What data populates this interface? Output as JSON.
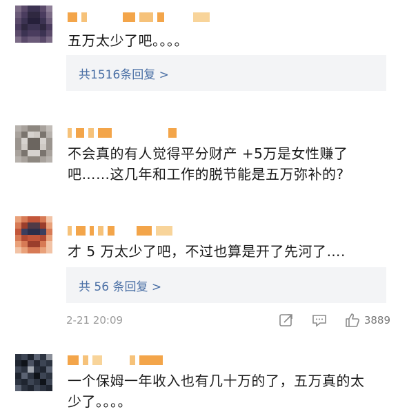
{
  "comments": [
    {
      "text_lines": [
        "五万太少了吧。。。。"
      ],
      "replies": "共1516条回复 >"
    },
    {
      "text_lines": [
        "不会真的有人觉得平分财产 +5万是女性赚了",
        "吧……这几年和工作的脱节能是五万弥补的?"
      ]
    },
    {
      "text_lines": [
        "才 5 万太少了吧，不过也算是开了先河了…."
      ],
      "replies": "共 56 条回复 >",
      "timestamp": "2-21 20:09",
      "like_count": "3889"
    },
    {
      "text_lines": [
        "一个保姆一年收入也有几十万的了，五万真的太",
        "少了。。。。"
      ]
    }
  ],
  "icons": {
    "share": "share-icon",
    "comment": "comment-icon",
    "like": "thumbs-up-icon"
  },
  "colors": {
    "reply_link": "#4a6fa5",
    "reply_bg": "#f3f4f6",
    "meta_gray": "#9a9a9a"
  }
}
